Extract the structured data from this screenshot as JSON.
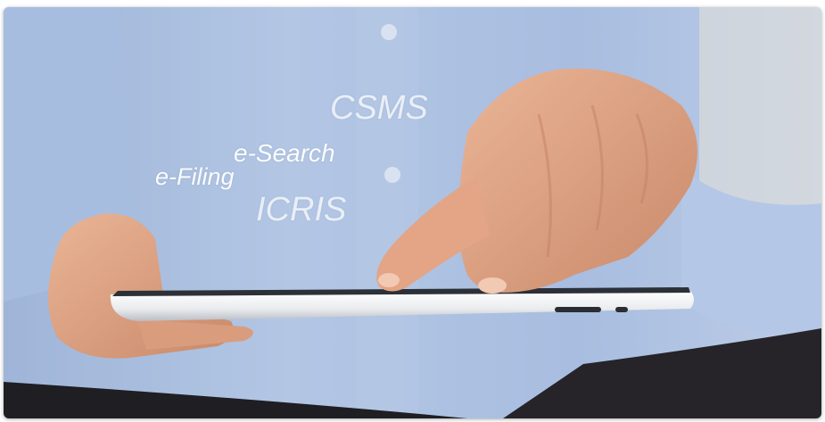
{
  "photo": {
    "description_icon": "hand-touching-tablet",
    "colors": {
      "shirt": "#a9bfdf",
      "shirt_shadow": "#7f98c0",
      "background_right": "#e3ddd2",
      "skin": "#e6a98c",
      "skin_shadow": "#b97656",
      "tablet_body": "#f1f2f4",
      "tablet_screen": "#2b2f36",
      "dark_pants": "#1e1d22"
    }
  },
  "floating_words": {
    "csms": "CSMS",
    "esearch": "e-Search",
    "efiling": "e-Filing",
    "icris": "ICRIS"
  }
}
